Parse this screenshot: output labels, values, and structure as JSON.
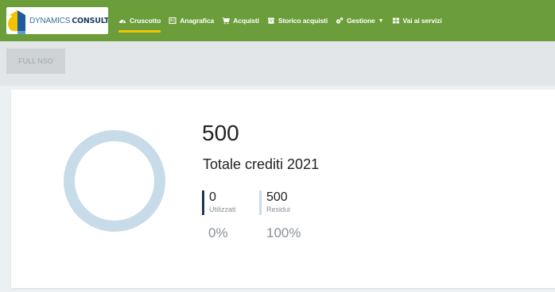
{
  "brand": {
    "name_part1": "DYNAMICS",
    "name_part2": "CONSULT"
  },
  "nav": {
    "items": [
      {
        "label": "Cruscotto",
        "icon": "dashboard-icon",
        "active": true
      },
      {
        "label": "Anagrafica",
        "icon": "id-card-icon",
        "active": false
      },
      {
        "label": "Acquisti",
        "icon": "cart-icon",
        "active": false
      },
      {
        "label": "Storico acquisti",
        "icon": "archive-icon",
        "active": false
      },
      {
        "label": "Gestione",
        "icon": "gears-icon",
        "active": false,
        "dropdown": true
      },
      {
        "label": "Vai ai servizi",
        "icon": "grid-icon",
        "active": false
      }
    ]
  },
  "toolbar": {
    "full_button_label": "FULL NSO"
  },
  "credits": {
    "total": "500",
    "total_label": "Totale crediti 2021",
    "used_value": "0",
    "used_label": "Utilizzati",
    "used_percent": "0%",
    "remaining_value": "500",
    "remaining_label": "Residui",
    "remaining_percent": "100%",
    "used_fraction": 0,
    "remaining_fraction": 1
  },
  "colors": {
    "navbar": "#6b9e3a",
    "accent_underline": "#f2c200",
    "donut_remaining": "#c7dbe8",
    "donut_used": "#1e3850"
  }
}
